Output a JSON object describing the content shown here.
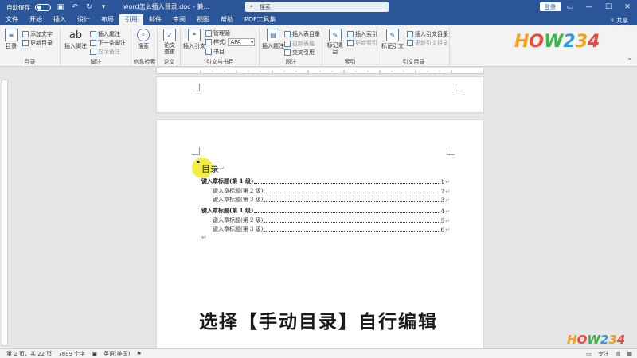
{
  "titlebar": {
    "autosave_label": "自动保存",
    "autosave_state": "关",
    "doc_title": "word怎么插入目录.doc - 兼...",
    "search_placeholder": "搜索",
    "login_label": "登录"
  },
  "menu": {
    "items": [
      "文件",
      "开始",
      "插入",
      "设计",
      "布局",
      "引用",
      "邮件",
      "审阅",
      "视图",
      "帮助",
      "PDF工具集"
    ],
    "active_index": 5,
    "share_label": "共享"
  },
  "ribbon": {
    "groups": {
      "toc": {
        "label": "目录",
        "toc_button": "目录",
        "add_text": "添加文字",
        "update_toc": "更新目录"
      },
      "footnotes": {
        "label": "脚注",
        "insert_footnote": "插入脚注",
        "insert_endnote": "插入尾注",
        "next_footnote": "下一条脚注",
        "show_notes": "显示备注",
        "ab_glyph": "ab"
      },
      "research": {
        "label": "信息检索",
        "search": "搜索"
      },
      "thesis": {
        "label": "论文",
        "thesis_check": "论文查重"
      },
      "citations": {
        "label": "引文与书目",
        "insert_citation": "插入引文",
        "manage_sources": "管理源",
        "style_label": "样式:",
        "style_value": "APA",
        "bibliography": "书目"
      },
      "captions": {
        "label": "题注",
        "insert_caption": "插入题注",
        "insert_table_of_figures": "插入表目录",
        "update_table": "更新表格",
        "cross_reference": "交叉引用"
      },
      "index": {
        "label": "索引",
        "mark_entry": "标记条目",
        "insert_index": "插入索引",
        "update_index": "更新索引"
      },
      "authorities": {
        "label": "引文目录",
        "mark_citation": "标记引文",
        "insert_toa": "插入引文目录",
        "update_toa": "更新引文目录"
      }
    }
  },
  "document": {
    "toc_title": "目录",
    "paragraph_mark": "↵",
    "entries": [
      {
        "level": 1,
        "text": "键入章标题(第 1 级)",
        "page": "1"
      },
      {
        "level": 2,
        "text": "键入章标题(第 2 级)",
        "page": "2"
      },
      {
        "level": 2,
        "text": "键入章标题(第 3 级)",
        "page": "3"
      },
      {
        "level": 1,
        "text": "键入章标题(第 1 级)",
        "page": "4"
      },
      {
        "level": 2,
        "text": "键入章标题(第 2 级)",
        "page": "5"
      },
      {
        "level": 2,
        "text": "键入章标题(第 3 级)",
        "page": "6"
      }
    ]
  },
  "subtitle": "选择【手动目录】自行编辑",
  "watermark": "HOW234",
  "statusbar": {
    "page": "第 2 页，共 22 页",
    "words": "7699 个字",
    "language": "英语(美国)",
    "focus": "专注"
  }
}
